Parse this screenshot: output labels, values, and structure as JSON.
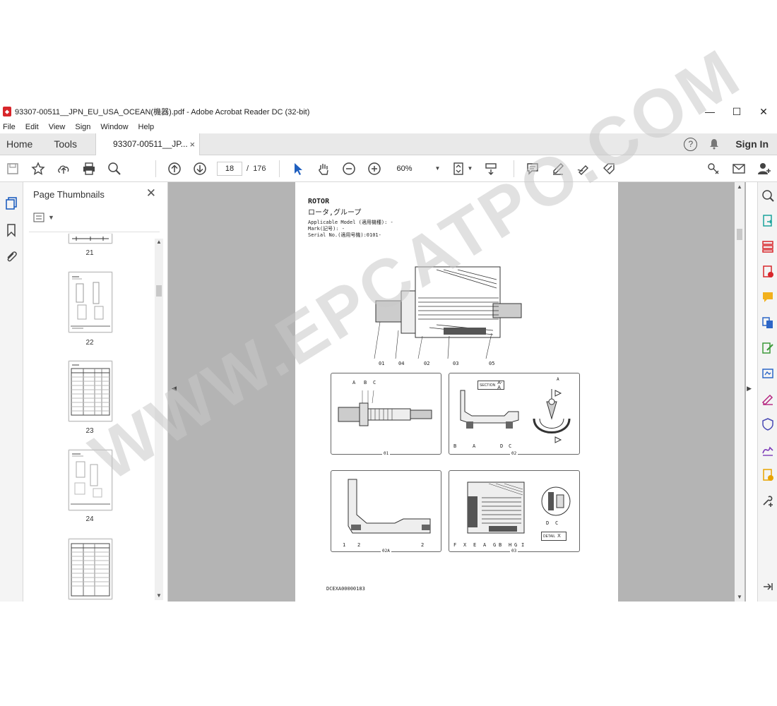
{
  "window": {
    "title": "93307-00511__JPN_EU_USA_OCEAN(機器).pdf - Adobe Acrobat Reader DC (32-bit)",
    "minimize": "—",
    "maximize": "☐",
    "close": "✕"
  },
  "menu": [
    "File",
    "Edit",
    "View",
    "Sign",
    "Window",
    "Help"
  ],
  "tabs": {
    "home": "Home",
    "tools": "Tools",
    "document": "93307-00511__JP...",
    "close": "×",
    "signin": "Sign In"
  },
  "toolbar": {
    "page_current": "18",
    "page_separator": "/",
    "page_total": "176",
    "zoom": "60%"
  },
  "thumbnails": {
    "header": "Page Thumbnails",
    "close": "✕",
    "pages": [
      "21",
      "22",
      "23",
      "24"
    ]
  },
  "document_page": {
    "title_en": "ROTOR",
    "title_jp": "ロータ,グループ",
    "applicable_model": "Applicable Model (適用機種): -",
    "mark": "Mark(記号): -",
    "serial": "Serial No.(適用号機):0101-",
    "callouts_main": [
      "01",
      "04",
      "02",
      "03",
      "05"
    ],
    "panel_01_labels": [
      "A",
      "B",
      "C"
    ],
    "panel_01_caption": "01",
    "panel_02_section": "SECTION",
    "panel_02_section_id": "A-A",
    "panel_02_labels": [
      "B",
      "A",
      "D",
      "C"
    ],
    "panel_02_arrow": "A",
    "panel_02_caption": "02",
    "panel_02a_labels": [
      "1",
      "2",
      "2"
    ],
    "panel_02a_caption": "02A",
    "panel_03_labels": [
      "F",
      "X",
      "E",
      "A",
      "G",
      "B",
      "H",
      "G",
      "I"
    ],
    "panel_03_detail_labels": [
      "D",
      "C"
    ],
    "panel_03_detail": "DETAIL",
    "panel_03_detail_id": "X",
    "panel_03_caption": "03",
    "footer_code": "DCEXA00000183"
  },
  "watermark": "WWW.EPCATPO.COM"
}
